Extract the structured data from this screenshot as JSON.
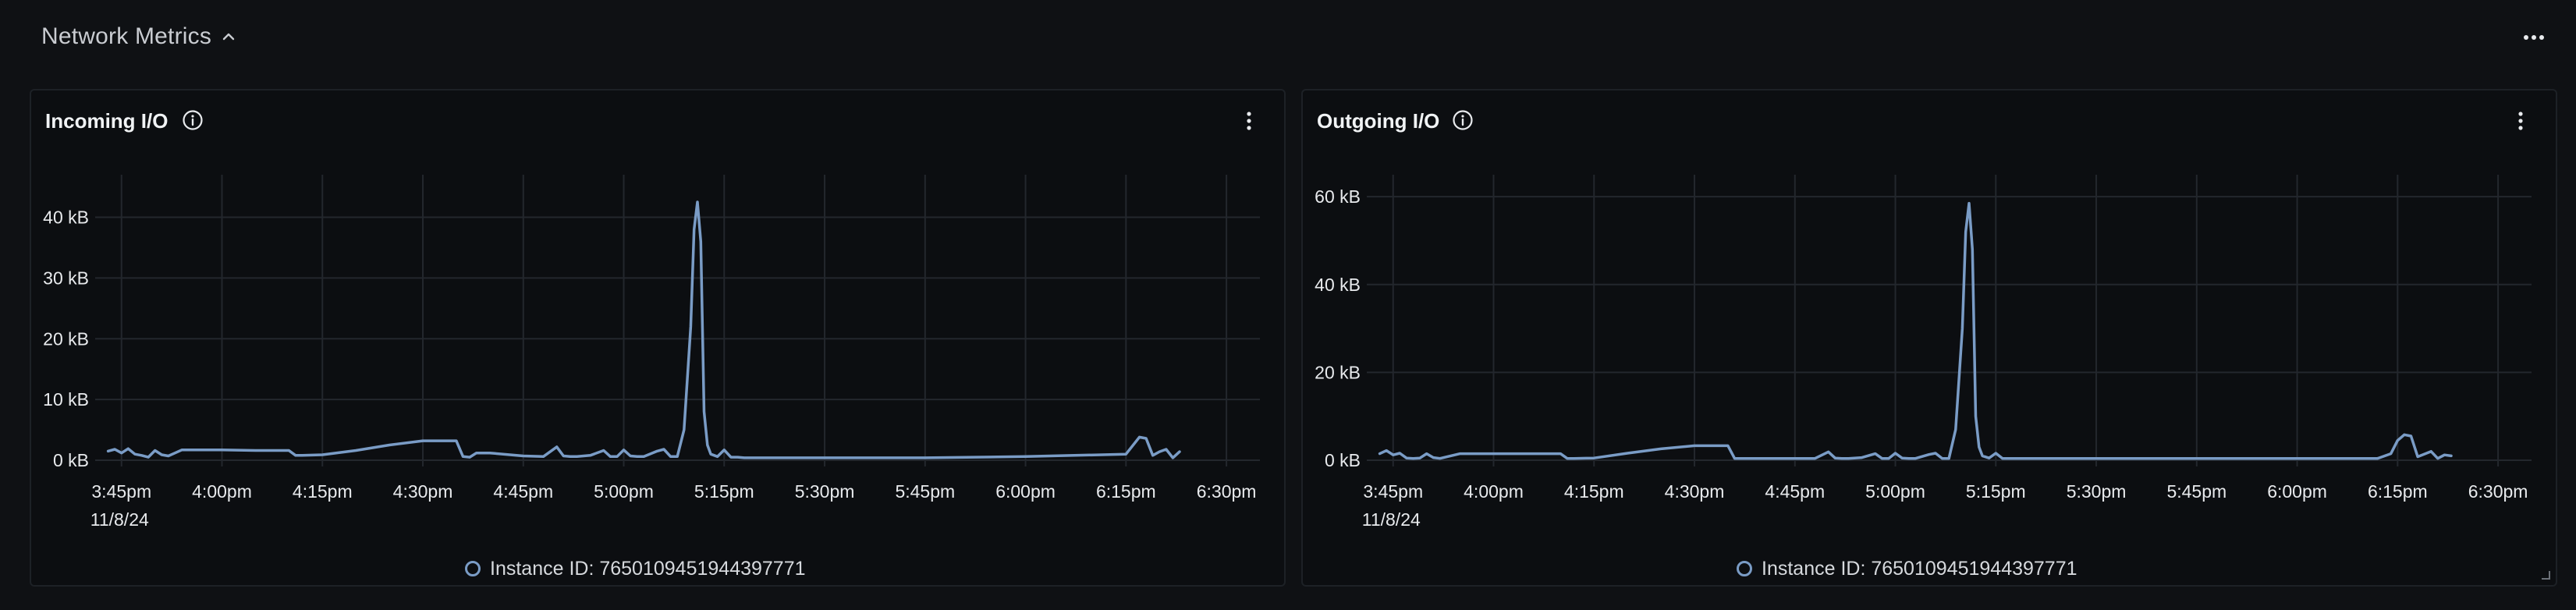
{
  "section": {
    "title": "Network Metrics",
    "collapse_icon": "chevron-up-icon",
    "menu_icon": "more-horizontal-icon"
  },
  "panels": [
    {
      "title": "Incoming I/O",
      "info_icon": "info-icon",
      "menu_icon": "more-vertical-icon",
      "legend": "Instance ID: 7650109451944397771"
    },
    {
      "title": "Outgoing I/O",
      "info_icon": "info-icon",
      "menu_icon": "more-vertical-icon",
      "legend": "Instance ID: 7650109451944397771"
    }
  ],
  "colors": {
    "line": "#7a9cc6",
    "grid": "#23272d",
    "axis_text": "#e8eaed",
    "background": "#0c0e11"
  },
  "chart_data": [
    {
      "type": "line",
      "title": "Incoming I/O",
      "x_tick_labels": [
        "3:45pm",
        "4:00pm",
        "4:15pm",
        "4:30pm",
        "4:45pm",
        "5:00pm",
        "5:15pm",
        "5:30pm",
        "5:45pm",
        "6:00pm",
        "6:15pm",
        "6:30pm"
      ],
      "x_date_label": "11/8/24",
      "x_tick_minutes": [
        225,
        240,
        255,
        270,
        285,
        300,
        315,
        330,
        345,
        360,
        375,
        390
      ],
      "xlim_minutes": [
        222,
        395
      ],
      "y_tick_labels": [
        "0 kB",
        "10 kB",
        "20 kB",
        "30 kB",
        "40 kB"
      ],
      "y_ticks": [
        0,
        10,
        20,
        30,
        40
      ],
      "ylim": [
        0,
        47
      ],
      "unit": "kB",
      "grid": true,
      "legend_position": "bottom-center",
      "series": [
        {
          "name": "Instance ID: 7650109451944397771",
          "x": [
            223,
            224,
            225,
            226,
            227,
            228,
            229,
            230,
            231,
            232,
            233,
            234,
            235,
            236,
            237,
            238,
            240,
            245,
            250,
            251,
            252,
            255,
            260,
            265,
            270,
            275,
            276,
            277,
            278,
            280,
            285,
            288,
            290,
            291,
            292,
            293,
            295,
            297,
            298,
            299,
            300,
            301,
            302,
            303,
            305,
            306,
            307,
            308,
            309,
            310,
            310.5,
            311,
            311.5,
            312,
            312.5,
            313,
            314,
            315,
            316,
            317,
            318,
            330,
            345,
            360,
            375,
            376,
            377,
            378,
            379,
            380,
            381,
            382,
            383
          ],
          "y": [
            1.5,
            1.8,
            1.2,
            1.9,
            1.0,
            0.8,
            0.5,
            1.6,
            0.9,
            0.7,
            1.2,
            1.7,
            1.7,
            1.7,
            1.7,
            1.7,
            1.7,
            1.6,
            1.6,
            0.8,
            0.8,
            0.9,
            1.6,
            2.5,
            3.2,
            3.2,
            0.6,
            0.5,
            1.2,
            1.2,
            0.7,
            0.6,
            2.2,
            0.7,
            0.6,
            0.6,
            0.8,
            1.6,
            0.6,
            0.6,
            1.7,
            0.7,
            0.6,
            0.6,
            1.5,
            1.8,
            0.6,
            0.6,
            5,
            22,
            38,
            42.5,
            36,
            8,
            2.5,
            1.0,
            0.6,
            1.7,
            0.5,
            0.5,
            0.4,
            0.4,
            0.4,
            0.6,
            1.0,
            2.4,
            3.8,
            3.6,
            0.8,
            1.4,
            1.8,
            0.4,
            1.4
          ]
        }
      ]
    },
    {
      "type": "line",
      "title": "Outgoing I/O",
      "x_tick_labels": [
        "3:45pm",
        "4:00pm",
        "4:15pm",
        "4:30pm",
        "4:45pm",
        "5:00pm",
        "5:15pm",
        "5:30pm",
        "5:45pm",
        "6:00pm",
        "6:15pm",
        "6:30pm"
      ],
      "x_date_label": "11/8/24",
      "x_tick_minutes": [
        225,
        240,
        255,
        270,
        285,
        300,
        315,
        330,
        345,
        360,
        375,
        390
      ],
      "xlim_minutes": [
        222,
        395
      ],
      "y_tick_labels": [
        "0 kB",
        "20 kB",
        "40 kB",
        "60 kB"
      ],
      "y_ticks": [
        0,
        20,
        40,
        60
      ],
      "ylim": [
        0,
        65
      ],
      "unit": "kB",
      "grid": true,
      "legend_position": "bottom-center",
      "series": [
        {
          "name": "Instance ID: 7650109451944397771",
          "x": [
            223,
            224,
            225,
            226,
            227,
            228,
            229,
            230,
            231,
            232,
            235,
            236,
            240,
            245,
            250,
            251,
            252,
            255,
            260,
            265,
            270,
            275,
            276,
            277,
            278,
            280,
            285,
            288,
            290,
            291,
            292,
            293,
            295,
            297,
            298,
            299,
            300,
            301,
            302,
            303,
            305,
            306,
            307,
            308,
            309,
            310,
            310.5,
            311,
            311.5,
            312,
            312.5,
            313,
            314,
            315,
            316,
            317,
            318,
            330,
            345,
            360,
            372,
            374,
            375,
            376,
            377,
            378,
            379,
            380,
            381,
            382,
            383
          ],
          "y": [
            1.5,
            2.2,
            1.2,
            1.6,
            0.5,
            0.4,
            0.5,
            1.5,
            0.6,
            0.4,
            1.5,
            1.5,
            1.5,
            1.5,
            1.5,
            0.4,
            0.4,
            0.5,
            1.6,
            2.6,
            3.3,
            3.3,
            0.4,
            0.4,
            0.4,
            0.4,
            0.4,
            0.4,
            1.9,
            0.5,
            0.4,
            0.4,
            0.6,
            1.5,
            0.4,
            0.4,
            1.6,
            0.5,
            0.4,
            0.4,
            1.3,
            1.6,
            0.4,
            0.4,
            7,
            30,
            52,
            58.5,
            48,
            10,
            3,
            1.0,
            0.5,
            1.6,
            0.4,
            0.4,
            0.4,
            0.4,
            0.4,
            0.4,
            0.4,
            1.5,
            4.5,
            5.8,
            5.5,
            0.8,
            1.4,
            2.0,
            0.4,
            1.2,
            1.0
          ]
        }
      ]
    }
  ]
}
